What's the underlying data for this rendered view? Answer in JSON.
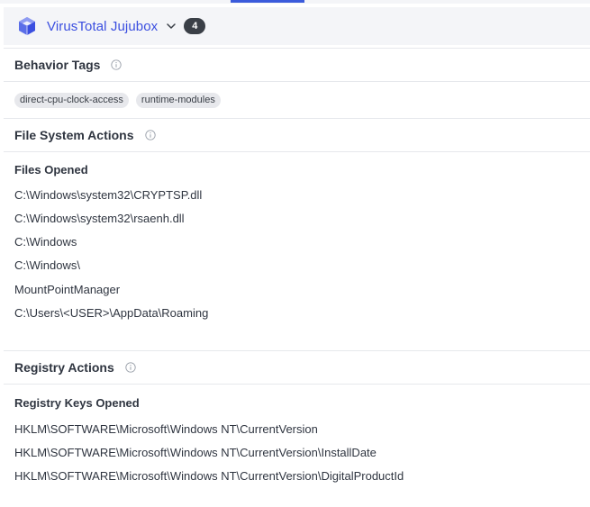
{
  "header": {
    "sandbox_name": "VirusTotal Jujubox",
    "count": "4",
    "logo_icon": "sandbox-cube-icon",
    "chevron_icon": "chevron-down-icon",
    "accent_color": "#3b4fe0"
  },
  "behavior_tags": {
    "title": "Behavior Tags",
    "tags": [
      "direct-cpu-clock-access",
      "runtime-modules"
    ]
  },
  "file_system": {
    "title": "File System Actions",
    "files_opened_title": "Files Opened",
    "files_opened": [
      "C:\\Windows\\system32\\CRYPTSP.dll",
      "C:\\Windows\\system32\\rsaenh.dll",
      "C:\\Windows",
      "C:\\Windows\\",
      "MountPointManager",
      "C:\\Users\\<USER>\\AppData\\Roaming"
    ]
  },
  "registry": {
    "title": "Registry Actions",
    "keys_opened_title": "Registry Keys Opened",
    "keys_opened": [
      "HKLM\\SOFTWARE\\Microsoft\\Windows NT\\CurrentVersion",
      "HKLM\\SOFTWARE\\Microsoft\\Windows NT\\CurrentVersion\\InstallDate",
      "HKLM\\SOFTWARE\\Microsoft\\Windows NT\\CurrentVersion\\DigitalProductId"
    ]
  }
}
